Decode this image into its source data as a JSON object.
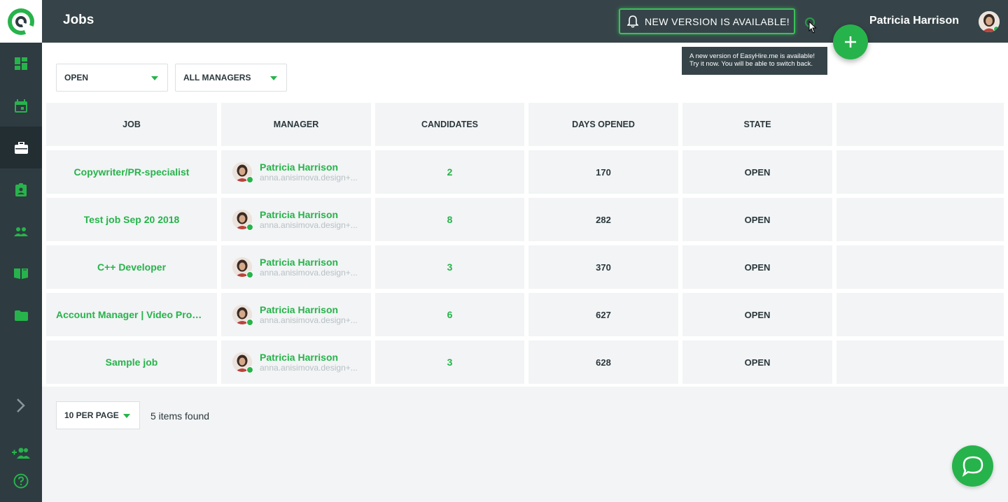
{
  "header": {
    "title": "Jobs",
    "new_version_label": "NEW VERSION IS AVAILABLE!",
    "user_name": "Patricia Harrison"
  },
  "tooltip": {
    "line1": "A new version of EasyHire.me is available!",
    "line2": "Try it now. You will be able to switch back."
  },
  "sidebar": {
    "items": [
      {
        "icon": "dashboard-icon"
      },
      {
        "icon": "calendar-icon"
      },
      {
        "icon": "briefcase-icon",
        "active": true
      },
      {
        "icon": "assignment-ind-icon"
      },
      {
        "icon": "people-icon"
      },
      {
        "icon": "book-icon"
      },
      {
        "icon": "folder-icon"
      },
      {
        "icon": "chevron-right-icon"
      },
      {
        "icon": "add-user-icon"
      },
      {
        "icon": "help-icon"
      }
    ]
  },
  "filters": {
    "status": "OPEN",
    "managers": "ALL MANAGERS"
  },
  "table": {
    "columns": [
      "JOB",
      "MANAGER",
      "CANDIDATES",
      "DAYS OPENED",
      "STATE",
      ""
    ],
    "rows": [
      {
        "job": "Copywriter/PR-specialist",
        "manager": "Patricia Harrison",
        "email": "anna.anisimova.design+...",
        "candidates": "2",
        "days": "170",
        "state": "OPEN"
      },
      {
        "job": "Test job Sep 20 2018",
        "manager": "Patricia Harrison",
        "email": "anna.anisimova.design+...",
        "candidates": "8",
        "days": "282",
        "state": "OPEN"
      },
      {
        "job": "C++ Developer",
        "manager": "Patricia Harrison",
        "email": "anna.anisimova.design+...",
        "candidates": "3",
        "days": "370",
        "state": "OPEN"
      },
      {
        "job": "Account Manager | Video Produ...",
        "manager": "Patricia Harrison",
        "email": "anna.anisimova.design+...",
        "candidates": "6",
        "days": "627",
        "state": "OPEN"
      },
      {
        "job": "Sample job",
        "manager": "Patricia Harrison",
        "email": "anna.anisimova.design+...",
        "candidates": "3",
        "days": "628",
        "state": "OPEN"
      }
    ]
  },
  "pagination": {
    "per_page": "10 PER PAGE",
    "items_found": "5 items found"
  },
  "colors": {
    "accent": "#27b34b",
    "sidebar": "#2e3b41",
    "header": "#364449"
  }
}
